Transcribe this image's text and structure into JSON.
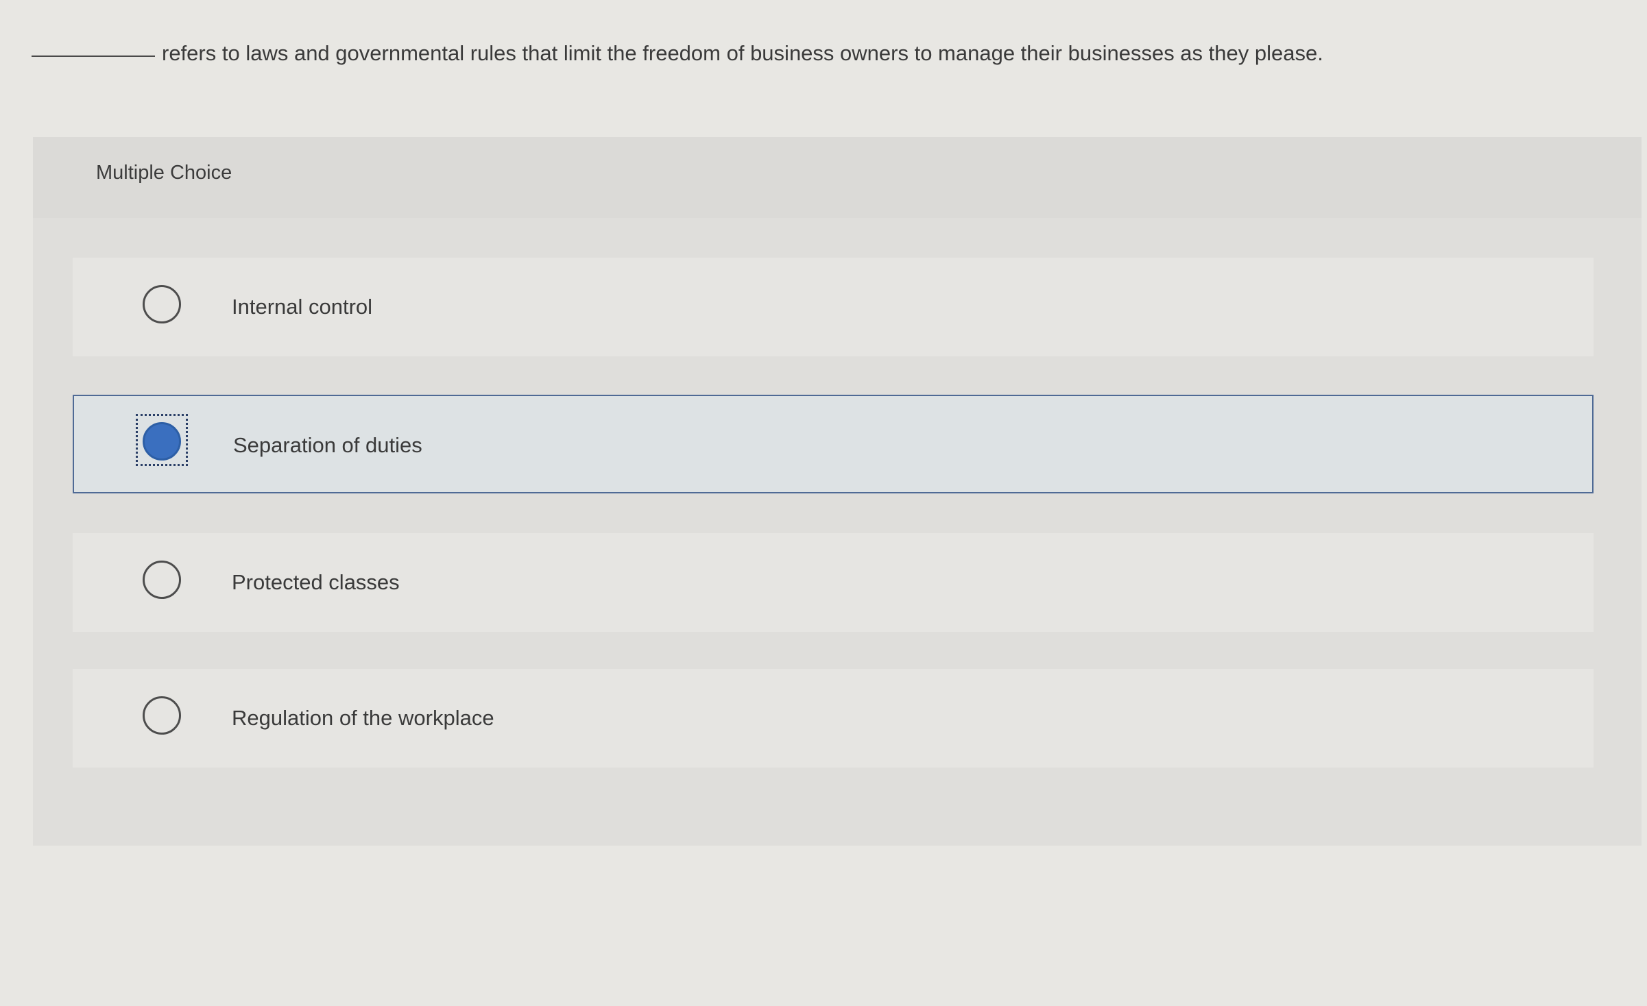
{
  "question": {
    "text": "refers to laws and governmental rules that limit the freedom of business owners to manage their businesses as they please."
  },
  "panel": {
    "title": "Multiple Choice"
  },
  "options": [
    {
      "label": "Internal control",
      "selected": false
    },
    {
      "label": "Separation of duties",
      "selected": true
    },
    {
      "label": "Protected classes",
      "selected": false
    },
    {
      "label": "Regulation of the workplace",
      "selected": false
    }
  ],
  "colors": {
    "selected_radio": "#3a6fbf",
    "selected_border": "#4f6a95"
  }
}
